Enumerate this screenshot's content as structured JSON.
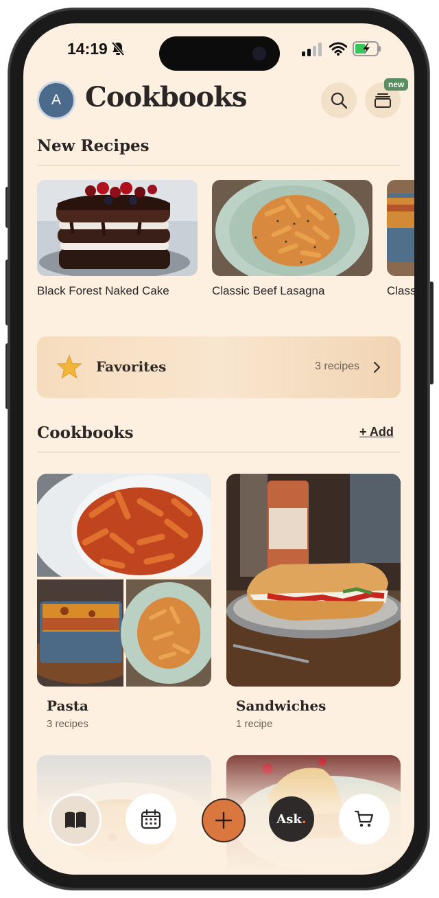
{
  "status_bar": {
    "time": "14:19",
    "icons": [
      "bell-slash-icon",
      "signal-icon",
      "wifi-icon",
      "battery-charging-icon"
    ]
  },
  "header": {
    "avatar_initial": "A",
    "title": "Cookbooks",
    "search_icon": "search-icon",
    "collections_icon": "stack-icon",
    "badge": "new"
  },
  "new_recipes": {
    "title": "New Recipes",
    "items": [
      {
        "label": "Black Forest Naked Cake"
      },
      {
        "label": "Classic Beef Lasagna"
      },
      {
        "label": "Class"
      }
    ]
  },
  "favorites": {
    "label": "Favorites",
    "count": "3 recipes",
    "icon": "star-icon"
  },
  "cookbooks": {
    "title": "Cookbooks",
    "add_label": "+ Add",
    "items": [
      {
        "name": "Pasta",
        "count": "3 recipes"
      },
      {
        "name": "Sandwiches",
        "count": "1 recipe"
      }
    ]
  },
  "bottom_nav": {
    "items": [
      {
        "icon": "book-icon"
      },
      {
        "icon": "calendar-icon"
      },
      {
        "icon": "plus-icon"
      },
      {
        "label": "Ask"
      },
      {
        "icon": "cart-icon"
      }
    ]
  },
  "colors": {
    "background": "#fdf0e0",
    "accent_orange": "#d9773f",
    "badge_green": "#5b8d62",
    "avatar_blue": "#4b6a8c"
  }
}
